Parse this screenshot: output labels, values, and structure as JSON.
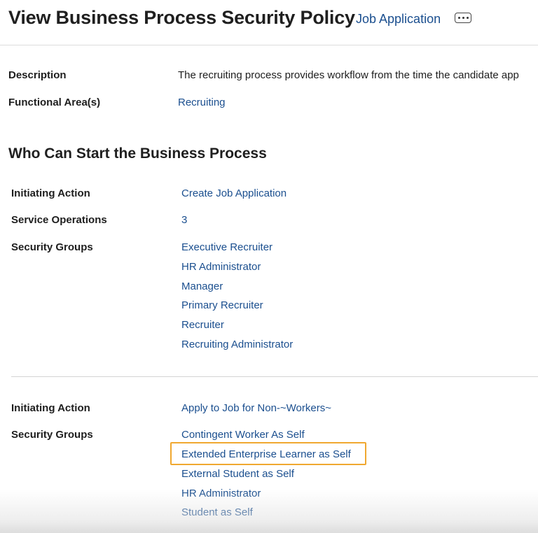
{
  "header": {
    "title": "View Business Process Security Policy",
    "link": "Job Application",
    "more_icon": "ellipsis-icon"
  },
  "details": {
    "description_label": "Description",
    "description_value": "The recruiting process provides workflow from the time the candidate app",
    "functional_area_label": "Functional Area(s)",
    "functional_area_value": "Recruiting"
  },
  "section": {
    "title": "Who Can Start the Business Process"
  },
  "policy1": {
    "initiating_action_label": "Initiating Action",
    "initiating_action_value": "Create Job Application",
    "service_operations_label": "Service Operations",
    "service_operations_value": "3",
    "security_groups_label": "Security Groups",
    "security_groups": [
      "Executive Recruiter",
      "HR Administrator",
      "Manager",
      "Primary Recruiter",
      "Recruiter",
      "Recruiting Administrator"
    ]
  },
  "policy2": {
    "initiating_action_label": "Initiating Action",
    "initiating_action_value": "Apply to Job for Non-~Workers~",
    "security_groups_label": "Security Groups",
    "security_groups": [
      "Contingent Worker As Self",
      "Extended Enterprise Learner as Self",
      "External Student as Self",
      "HR Administrator",
      "Student as Self"
    ],
    "highlight_color": "#f0a830"
  },
  "colors": {
    "link": "#1b4f8f",
    "text": "#1e1e1e"
  }
}
